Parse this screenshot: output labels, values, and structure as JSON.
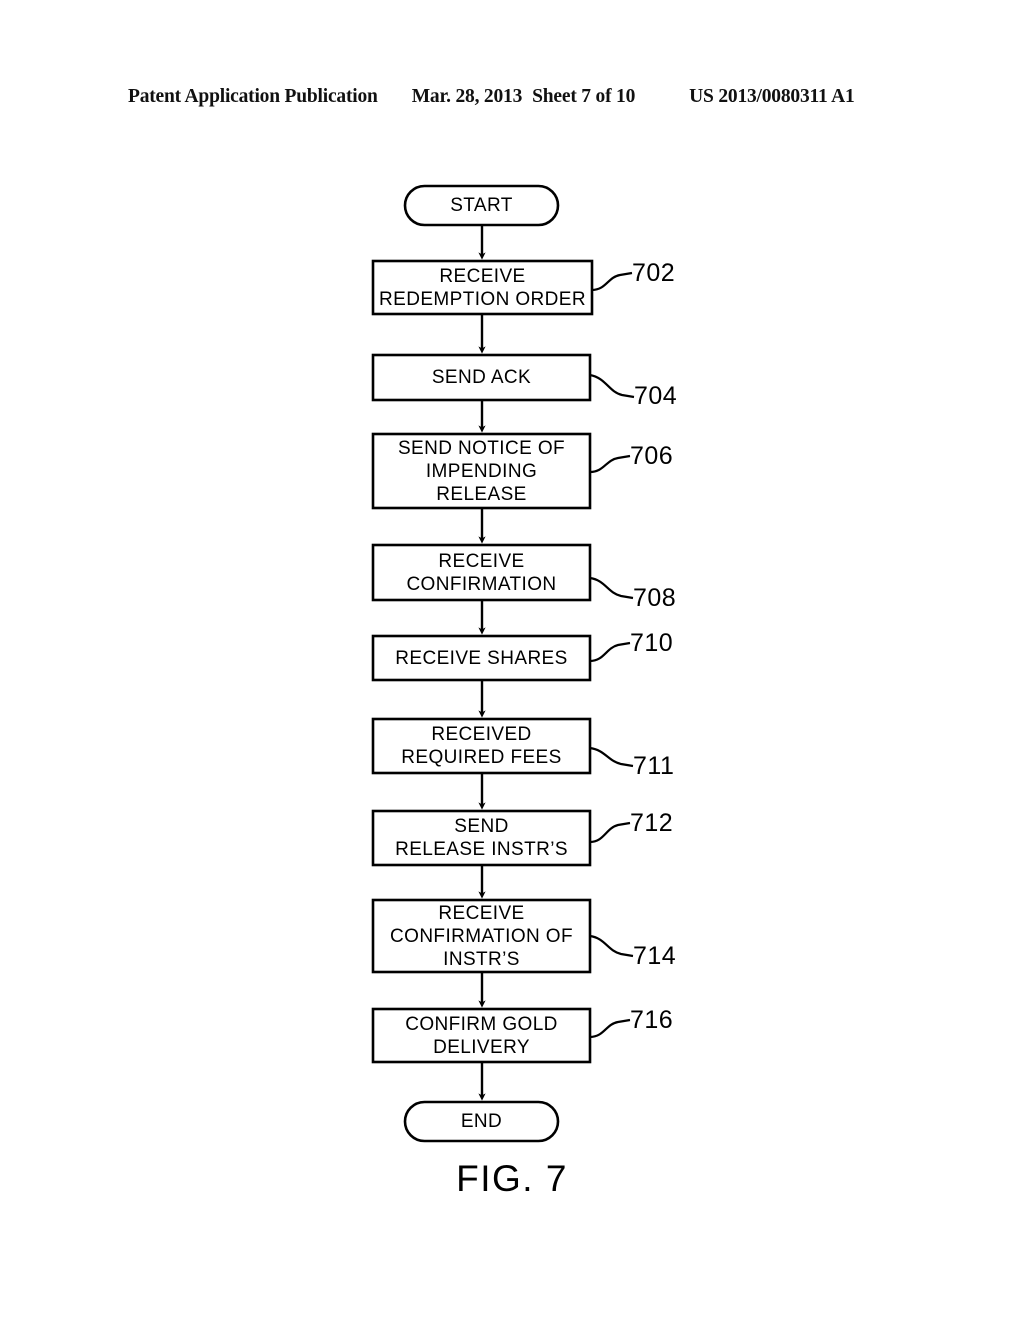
{
  "header": {
    "publication": "Patent Application Publication",
    "date": "Mar. 28, 2013",
    "sheet": "Sheet 7 of 10",
    "doc_number": "US 2013/0080311 A1"
  },
  "figure": {
    "caption": "FIG. 7",
    "line_color": "#000000",
    "fill_color": "#ffffff"
  },
  "flow": {
    "start": {
      "label": "START"
    },
    "end": {
      "label": "END"
    },
    "steps": [
      {
        "ref": "702",
        "label": "RECEIVE\nREDEMPTION ORDER"
      },
      {
        "ref": "704",
        "label": "SEND ACK"
      },
      {
        "ref": "706",
        "label": "SEND NOTICE OF\nIMPENDING\nRELEASE"
      },
      {
        "ref": "708",
        "label": "RECEIVE\nCONFIRMATION"
      },
      {
        "ref": "710",
        "label": "RECEIVE SHARES"
      },
      {
        "ref": "711",
        "label": "RECEIVED\nREQUIRED FEES"
      },
      {
        "ref": "712",
        "label": "SEND\nRELEASE INSTR’S"
      },
      {
        "ref": "714",
        "label": "RECEIVE\nCONFIRMATION OF\nINSTR’S"
      },
      {
        "ref": "716",
        "label": "CONFIRM GOLD\nDELIVERY"
      }
    ]
  }
}
